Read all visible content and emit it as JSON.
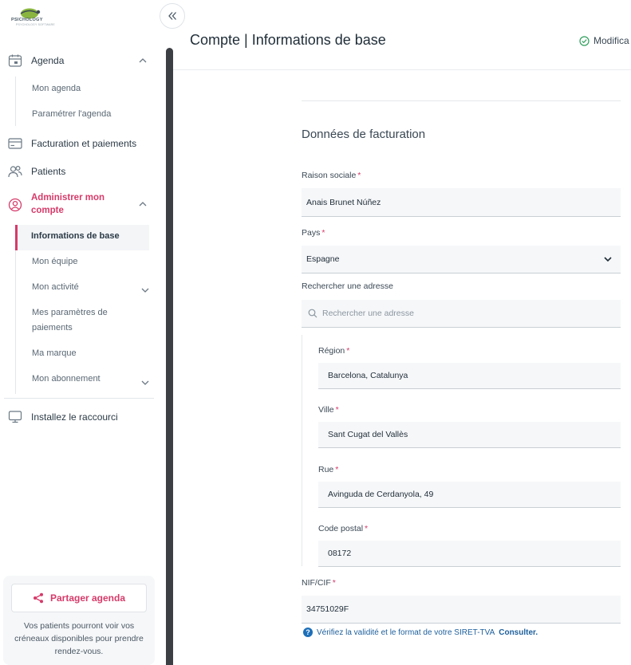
{
  "logo": {
    "text": "PSICHOLOGY",
    "sub": "PSYCHOLOGY SOFTWARE"
  },
  "sidebar": {
    "agenda": {
      "label": "Agenda",
      "sub": [
        "Mon agenda",
        "Paramétrer l'agenda"
      ]
    },
    "billing": "Facturation et paiements",
    "patients": "Patients",
    "account": {
      "label": "Administrer mon compte",
      "label_line1": "Administrer mon",
      "label_line2": "compte",
      "sub": [
        "Informations de base",
        "Mon équipe",
        "Mon activité",
        "Mes paramètres de",
        "paiements",
        "Ma marque",
        "Mon abonnement"
      ]
    },
    "shortcut": "Installez le raccourci",
    "share": {
      "button": "Partager agenda",
      "text": "Vos patients pourront voir vos créneaux disponibles pour prendre rendez-vous."
    }
  },
  "header": {
    "title": "Compte | Informations de base",
    "status": "Modifica"
  },
  "form": {
    "section_title": "Données de facturation",
    "raison_label": "Raison sociale",
    "raison_value": "Anais Brunet Núñez",
    "pays_label": "Pays",
    "pays_value": "Espagne",
    "search_label": "Rechercher une adresse",
    "search_placeholder": "Rechercher une adresse",
    "region_label": "Région",
    "region_value": "Barcelona, Catalunya",
    "ville_label": "Ville",
    "ville_value": "Sant Cugat del Vallès",
    "rue_label": "Rue",
    "rue_value": "Avinguda de Cerdanyola, 49",
    "cp_label": "Code postal",
    "cp_value": "08172",
    "nif_label": "NIF/CIF",
    "nif_value": "34751029F",
    "help_text": "Vérifiez la validité et le format de votre SIRET-TVA",
    "help_link": "Consulter."
  },
  "colors": {
    "accent": "#d63a6a",
    "info": "#1d6fb8",
    "success": "#2e9e5b"
  }
}
